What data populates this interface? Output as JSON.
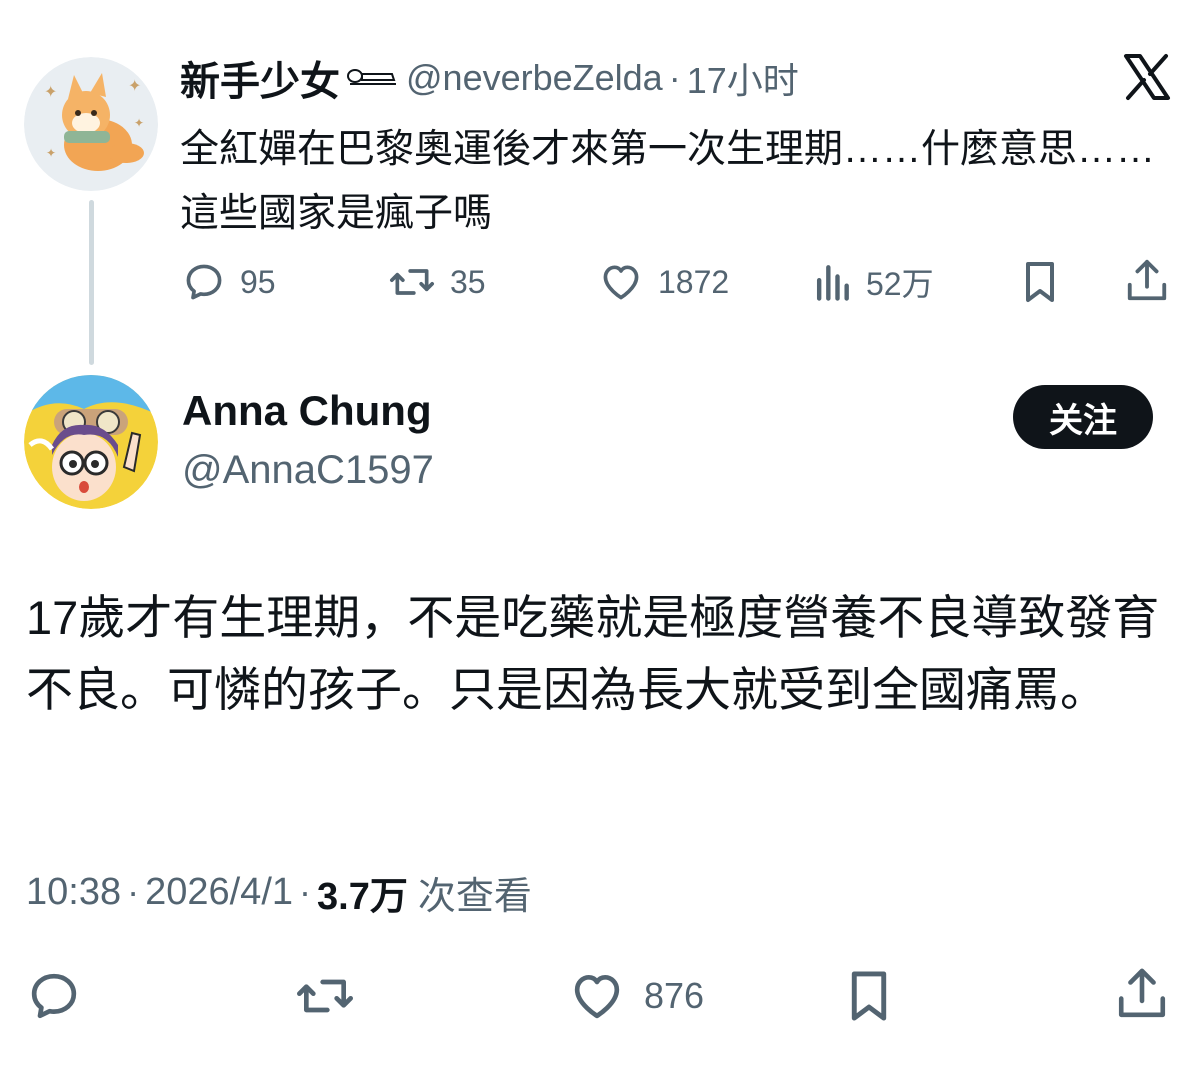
{
  "quoted_tweet": {
    "author_name": "新手少女",
    "emoji_icon": "lying-figure-emoji-icon",
    "handle": "@neverbeZelda",
    "separator": "·",
    "time": "17小时",
    "text": "全紅嬋在巴黎奧運後才來第一次生理期……什麼意思……這些國家是瘋子嗎",
    "metrics": {
      "replies": "95",
      "retweets": "35",
      "likes": "1872",
      "views": "52万"
    }
  },
  "brand_icon": "x-logo-icon",
  "tweet": {
    "author_name": "Anna Chung",
    "handle": "@AnnaC1597",
    "follow_label": "关注",
    "text": "17歲才有生理期，不是吃藥就是極度營養不良導致發育不良。可憐的孩子。只是因為長大就受到全國痛罵。",
    "time": "10:38",
    "date": "2026/4/1",
    "separator": "·",
    "views_count": "3.7万",
    "views_label": "次查看",
    "likes": "876"
  },
  "colors": {
    "text_primary": "#0f1419",
    "text_secondary": "#536471",
    "thread_line": "#cfd9de",
    "button_bg": "#0f1419"
  }
}
